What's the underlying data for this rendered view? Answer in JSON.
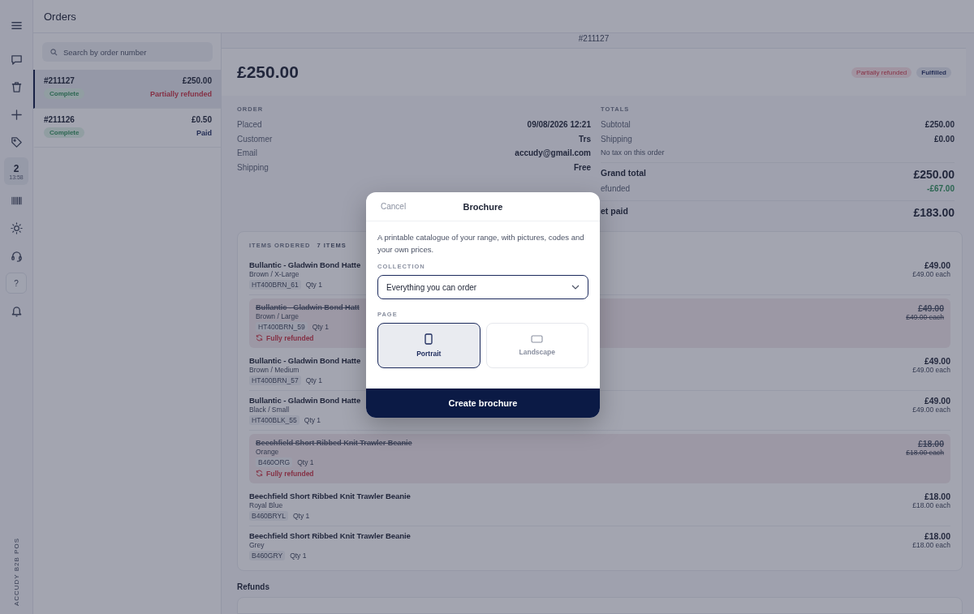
{
  "rail": {
    "items": [
      {
        "kind": "menu"
      },
      {
        "kind": "chat"
      },
      {
        "kind": "trash"
      },
      {
        "kind": "plus"
      },
      {
        "kind": "tag"
      },
      {
        "kind": "badge",
        "count": "2",
        "time": "13:58"
      },
      {
        "kind": "barcode"
      },
      {
        "kind": "sun"
      },
      {
        "kind": "headset"
      },
      {
        "kind": "help",
        "label": "?"
      },
      {
        "kind": "bell"
      }
    ],
    "brand": "ACCUDY B2B POS"
  },
  "header": {
    "title": "Orders"
  },
  "orders": {
    "search": {
      "placeholder": "Search by order number"
    },
    "items": [
      {
        "number": "#211127",
        "total": "£250.00",
        "status": "Complete",
        "payment": "Partially refunded",
        "kind": "refund",
        "selected": true
      },
      {
        "number": "#211126",
        "total": "£0.50",
        "status": "Complete",
        "payment": "Paid",
        "kind": "paid",
        "selected": false
      }
    ]
  },
  "order": {
    "number": "#211127",
    "amount": "£250.00",
    "badges": [
      {
        "label": "Partially refunded",
        "kind": "refund"
      },
      {
        "label": "Fulfilled",
        "kind": "neutral"
      }
    ],
    "details": {
      "heading": "ORDER",
      "rows": [
        {
          "label": "Placed",
          "value": "09/08/2026 12:21"
        },
        {
          "label": "Customer",
          "value": "Trs"
        },
        {
          "label": "Email",
          "value": "accudy@gmail.com"
        },
        {
          "label": "Shipping",
          "value": "Free"
        }
      ]
    },
    "totals": {
      "heading": "TOTALS",
      "rows": [
        {
          "kind": "line",
          "label": "Subtotal",
          "value": "£250.00"
        },
        {
          "kind": "line",
          "label": "Shipping",
          "value": "£0.00"
        },
        {
          "kind": "note",
          "label": "No tax on this order"
        },
        {
          "kind": "grand",
          "label": "Grand total",
          "value": "£250.00"
        },
        {
          "kind": "refund",
          "label": "efunded",
          "value": "-£67.00"
        },
        {
          "kind": "grand",
          "label": "et paid",
          "value": "£183.00"
        }
      ]
    },
    "items": {
      "heading": "ITEMS ORDERED",
      "count": "7 ITEMS",
      "rows": [
        {
          "name": "Bullantic - Gladwin Bond Hatte",
          "variant": "Brown / X-Large",
          "sku": "HT400BRN_61",
          "qty": "Qty 1",
          "price": "£49.00",
          "each": "£49.00 each",
          "refunded": false
        },
        {
          "name": "Bullantic - Gladwin Bond Hatt",
          "variant": "Brown / Large",
          "sku": "HT400BRN_59",
          "qty": "Qty 1",
          "price": "£49.00",
          "each": "£49.00 each",
          "refunded": true,
          "refund_note": "Fully refunded"
        },
        {
          "name": "Bullantic - Gladwin Bond Hatte",
          "variant": "Brown / Medium",
          "sku": "HT400BRN_57",
          "qty": "Qty 1",
          "price": "£49.00",
          "each": "£49.00 each",
          "refunded": false
        },
        {
          "name": "Bullantic - Gladwin Bond Hatte",
          "variant": "Black / Small",
          "sku": "HT400BLK_55",
          "qty": "Qty 1",
          "price": "£49.00",
          "each": "£49.00 each",
          "refunded": false
        },
        {
          "name": "Beechfield Short Ribbed Knit Trawler Beanie",
          "variant": "Orange",
          "sku": "B460ORG",
          "qty": "Qty 1",
          "price": "£18.00",
          "each": "£18.00 each",
          "refunded": true,
          "refund_note": "Fully refunded"
        },
        {
          "name": "Beechfield Short Ribbed Knit Trawler Beanie",
          "variant": "Royal Blue",
          "sku": "B460BRYL",
          "qty": "Qty 1",
          "price": "£18.00",
          "each": "£18.00 each",
          "refunded": false
        },
        {
          "name": "Beechfield Short Ribbed Knit Trawler Beanie",
          "variant": "Grey",
          "sku": "B460GRY",
          "qty": "Qty 1",
          "price": "£18.00",
          "each": "£18.00 each",
          "refunded": false
        }
      ]
    },
    "refunds": {
      "heading": "Refunds"
    }
  },
  "modal": {
    "cancel": "Cancel",
    "title": "Brochure",
    "description": "A printable catalogue of your range, with pictures, codes and your own prices.",
    "collection": {
      "label": "COLLECTION",
      "value": "Everything you can order"
    },
    "page": {
      "label": "PAGE",
      "options": [
        {
          "label": "Portrait",
          "kind": "portrait",
          "selected": true
        },
        {
          "label": "Landscape",
          "kind": "landscape",
          "selected": false
        }
      ]
    },
    "submit": "Create brochure"
  }
}
